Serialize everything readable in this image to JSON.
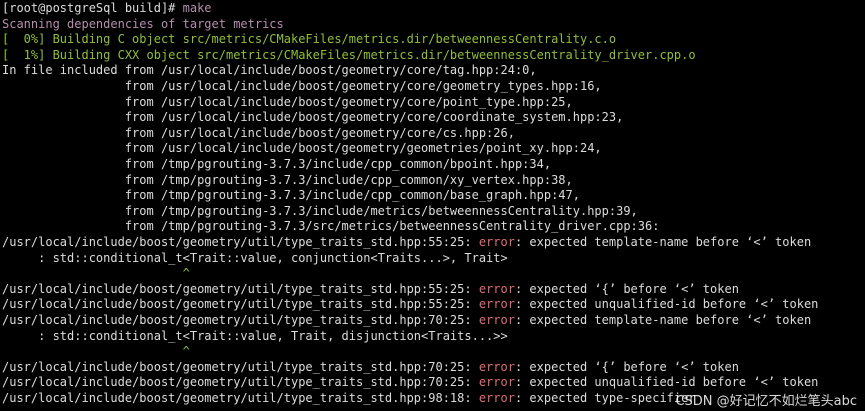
{
  "colors": {
    "text": "#dcdcdc",
    "scan": "#b48ead",
    "progress": "#8fbf3a",
    "error": "#e06c75",
    "background": "#000000"
  },
  "watermark": "CSDN @好记忆不如烂笔头abc",
  "lines": [
    [
      {
        "t": "[root@postgreSql build]# ",
        "c": "text"
      },
      {
        "t": "make",
        "c": "scan"
      }
    ],
    [
      {
        "t": "Scanning dependencies of target metrics",
        "c": "scan"
      }
    ],
    [
      {
        "t": "[  0%] Building C object src/metrics/CMakeFiles/metrics.dir/betweennessCentrality.c.o",
        "c": "progress"
      }
    ],
    [
      {
        "t": "[  1%] Building CXX object src/metrics/CMakeFiles/metrics.dir/betweennessCentrality_driver.cpp.o",
        "c": "progress"
      }
    ],
    [
      {
        "t": "In file included from /usr/local/include/boost/geometry/core/tag.hpp:24:0,",
        "c": "text"
      }
    ],
    [
      {
        "t": "                 from /usr/local/include/boost/geometry/core/geometry_types.hpp:16,",
        "c": "text"
      }
    ],
    [
      {
        "t": "                 from /usr/local/include/boost/geometry/core/point_type.hpp:25,",
        "c": "text"
      }
    ],
    [
      {
        "t": "                 from /usr/local/include/boost/geometry/core/coordinate_system.hpp:23,",
        "c": "text"
      }
    ],
    [
      {
        "t": "                 from /usr/local/include/boost/geometry/core/cs.hpp:26,",
        "c": "text"
      }
    ],
    [
      {
        "t": "                 from /usr/local/include/boost/geometry/geometries/point_xy.hpp:24,",
        "c": "text"
      }
    ],
    [
      {
        "t": "                 from /tmp/pgrouting-3.7.3/include/cpp_common/bpoint.hpp:34,",
        "c": "text"
      }
    ],
    [
      {
        "t": "                 from /tmp/pgrouting-3.7.3/include/cpp_common/xy_vertex.hpp:38,",
        "c": "text"
      }
    ],
    [
      {
        "t": "                 from /tmp/pgrouting-3.7.3/include/cpp_common/base_graph.hpp:47,",
        "c": "text"
      }
    ],
    [
      {
        "t": "                 from /tmp/pgrouting-3.7.3/include/metrics/betweennessCentrality.hpp:39,",
        "c": "text"
      }
    ],
    [
      {
        "t": "                 from /tmp/pgrouting-3.7.3/src/metrics/betweennessCentrality_driver.cpp:36:",
        "c": "text"
      }
    ],
    [
      {
        "t": "/usr/local/include/boost/geometry/util/type_traits_std.hpp:55:25: ",
        "c": "text"
      },
      {
        "t": "error",
        "c": "error"
      },
      {
        "t": ": expected template-name before ‘<’ token",
        "c": "text"
      }
    ],
    [
      {
        "t": "     : std::conditional_t<Trait::value, conjunction<Traits...>, Trait>",
        "c": "text"
      }
    ],
    [
      {
        "t": "                         ^",
        "c": "progress"
      }
    ],
    [
      {
        "t": "/usr/local/include/boost/geometry/util/type_traits_std.hpp:55:25: ",
        "c": "text"
      },
      {
        "t": "error",
        "c": "error"
      },
      {
        "t": ": expected ‘{’ before ‘<’ token",
        "c": "text"
      }
    ],
    [
      {
        "t": "/usr/local/include/boost/geometry/util/type_traits_std.hpp:55:25: ",
        "c": "text"
      },
      {
        "t": "error",
        "c": "error"
      },
      {
        "t": ": expected unqualified-id before ‘<’ token",
        "c": "text"
      }
    ],
    [
      {
        "t": "/usr/local/include/boost/geometry/util/type_traits_std.hpp:70:25: ",
        "c": "text"
      },
      {
        "t": "error",
        "c": "error"
      },
      {
        "t": ": expected template-name before ‘<’ token",
        "c": "text"
      }
    ],
    [
      {
        "t": "     : std::conditional_t<Trait::value, Trait, disjunction<Traits...>>",
        "c": "text"
      }
    ],
    [
      {
        "t": "                         ^",
        "c": "progress"
      }
    ],
    [
      {
        "t": "/usr/local/include/boost/geometry/util/type_traits_std.hpp:70:25: ",
        "c": "text"
      },
      {
        "t": "error",
        "c": "error"
      },
      {
        "t": ": expected ‘{’ before ‘<’ token",
        "c": "text"
      }
    ],
    [
      {
        "t": "/usr/local/include/boost/geometry/util/type_traits_std.hpp:70:25: ",
        "c": "text"
      },
      {
        "t": "error",
        "c": "error"
      },
      {
        "t": ": expected unqualified-id before ‘<’ token",
        "c": "text"
      }
    ],
    [
      {
        "t": "/usr/local/include/boost/geometry/util/type_traits_std.hpp:98:18: ",
        "c": "text"
      },
      {
        "t": "error",
        "c": "error"
      },
      {
        "t": ": expected type-specifier",
        "c": "text"
      }
    ]
  ]
}
